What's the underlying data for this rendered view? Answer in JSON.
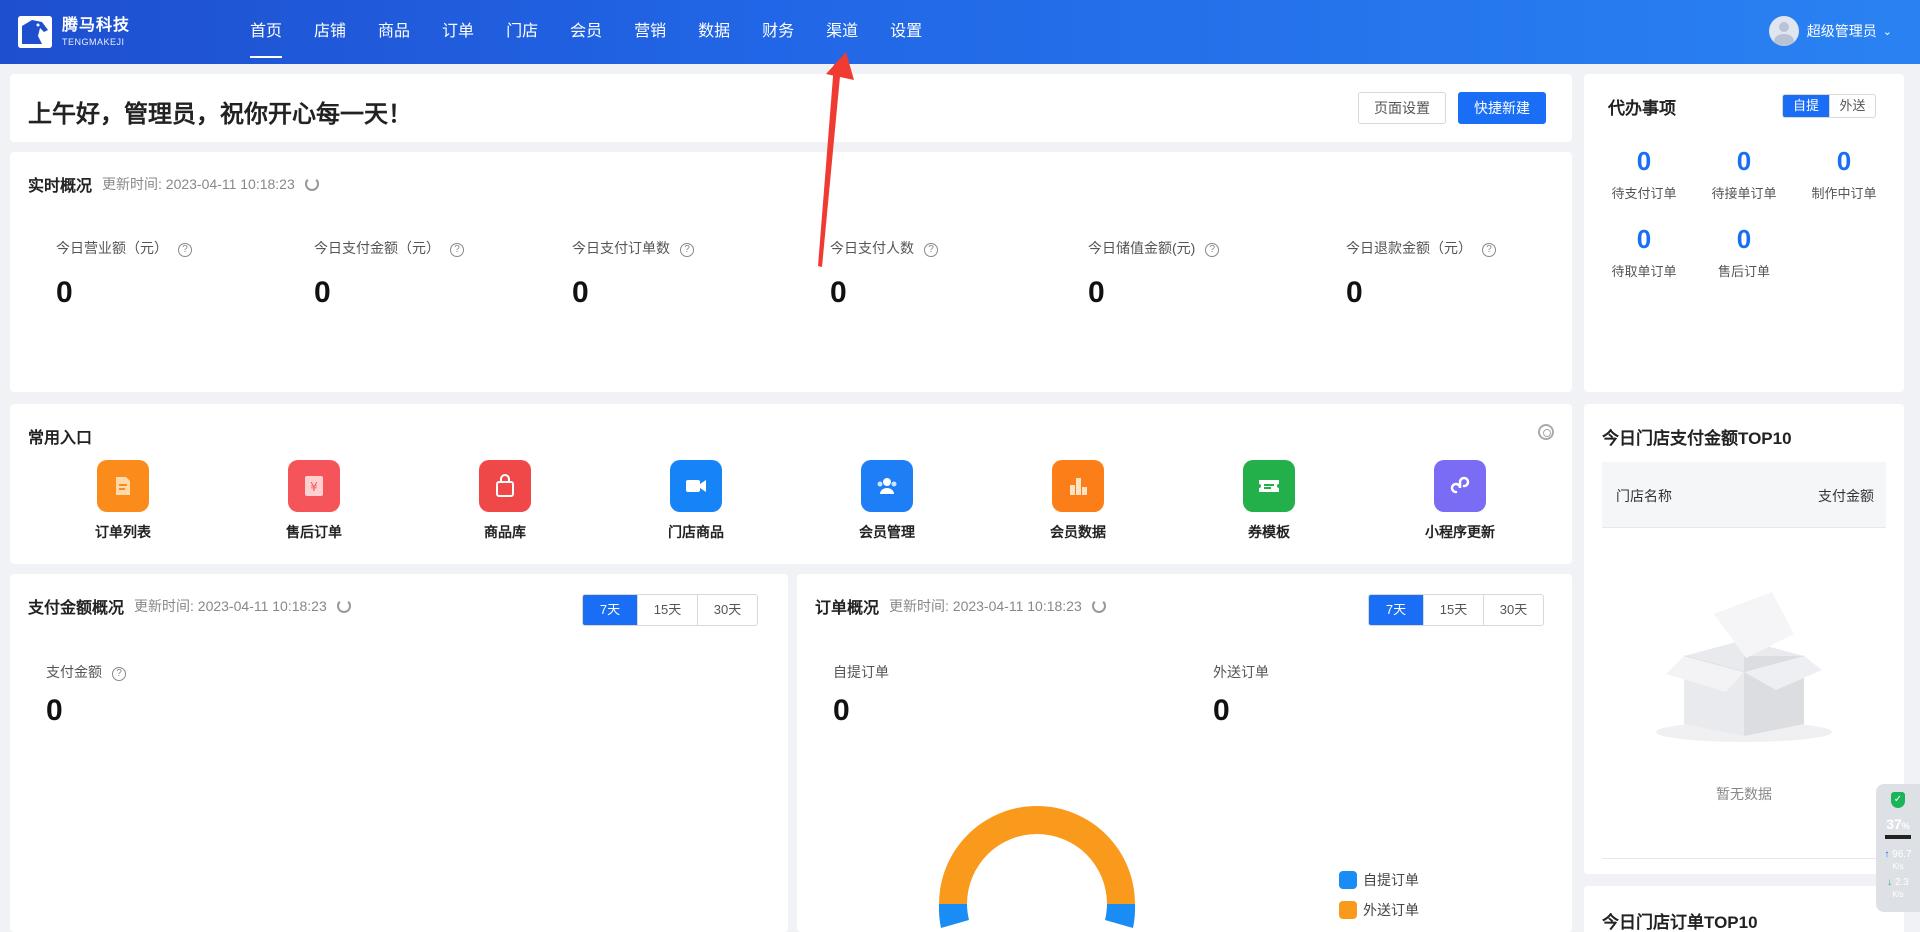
{
  "brand": {
    "name_cn": "腾马科技",
    "name_en": "TENGMAKEJI"
  },
  "nav": {
    "items": [
      "首页",
      "店铺",
      "商品",
      "订单",
      "门店",
      "会员",
      "营销",
      "数据",
      "财务",
      "渠道",
      "设置"
    ],
    "active": "首页"
  },
  "user": {
    "name": "超级管理员"
  },
  "greeting": {
    "text": "上午好，管理员，祝你开心每一天！",
    "page_settings": "页面设置",
    "quick_create": "快捷新建"
  },
  "realtime": {
    "title": "实时概况",
    "update": "更新时间:  2023-04-11 10:18:23",
    "metrics": [
      {
        "label": "今日营业额（元）",
        "value": "0"
      },
      {
        "label": "今日支付金额（元）",
        "value": "0"
      },
      {
        "label": "今日支付订单数",
        "value": "0"
      },
      {
        "label": "今日支付人数",
        "value": "0"
      },
      {
        "label": "今日储值金额(元)",
        "value": "0"
      },
      {
        "label": "今日退款金额（元）",
        "value": "0"
      }
    ]
  },
  "todo": {
    "title": "代办事项",
    "tabs": [
      "自提",
      "外送"
    ],
    "items": [
      {
        "value": "0",
        "label": "待支付订单"
      },
      {
        "value": "0",
        "label": "待接单订单"
      },
      {
        "value": "0",
        "label": "制作中订单"
      },
      {
        "value": "0",
        "label": "待取单订单"
      },
      {
        "value": "0",
        "label": "售后订单"
      }
    ]
  },
  "shortcuts": {
    "title": "常用入口",
    "items": [
      {
        "label": "订单列表",
        "icon": "document-icon",
        "color": "#fb8c1c"
      },
      {
        "label": "售后订单",
        "icon": "yen-receipt-icon",
        "color": "#f5555a"
      },
      {
        "label": "商品库",
        "icon": "shopping-bag-icon",
        "color": "#f04848"
      },
      {
        "label": "门店商品",
        "icon": "video-camera-icon",
        "color": "#1683f7"
      },
      {
        "label": "会员管理",
        "icon": "users-icon",
        "color": "#1d7ef5"
      },
      {
        "label": "会员数据",
        "icon": "bar-chart-icon",
        "color": "#fb7e18"
      },
      {
        "label": "券模板",
        "icon": "ticket-icon",
        "color": "#23b04b"
      },
      {
        "label": "小程序更新",
        "icon": "link-icon",
        "color": "#7b6cf5"
      }
    ]
  },
  "pay_overview": {
    "title": "支付金额概况",
    "update": "更新时间:  2023-04-11 10:18:23",
    "ranges": [
      "7天",
      "15天",
      "30天"
    ],
    "stat_label": "支付金额",
    "stat_value": "0"
  },
  "order_overview": {
    "title": "订单概况",
    "update": "更新时间:  2023-04-11 10:18:23",
    "ranges": [
      "7天",
      "15天",
      "30天"
    ],
    "pickup_label": "自提订单",
    "pickup_value": "0",
    "delivery_label": "外送订单",
    "delivery_value": "0",
    "legend": [
      {
        "label": "自提订单",
        "color": "#1a8cf5"
      },
      {
        "label": "外送订单",
        "color": "#fa9a1c"
      }
    ]
  },
  "top10_amount": {
    "title": "今日门店支付金额TOP10",
    "col_store": "门店名称",
    "col_amount": "支付金额",
    "empty": "暂无数据"
  },
  "top10_orders": {
    "title": "今日门店订单TOP10"
  },
  "widget": {
    "percent": "37",
    "percent_unit": "%",
    "up": "96.7",
    "down": "2.3",
    "unit": "K/s"
  }
}
